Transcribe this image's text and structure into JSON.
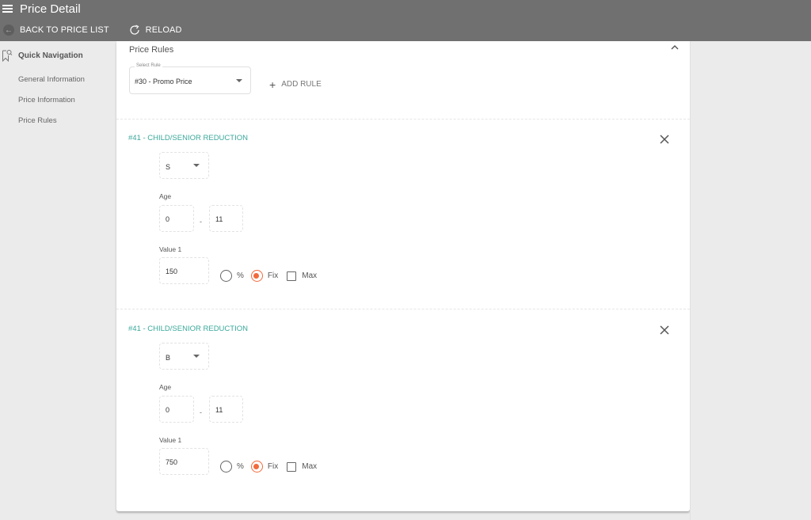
{
  "header": {
    "title": "Price Detail",
    "menu_icon": "hamburger-menu-icon",
    "back_label": "BACK TO PRICE LIST",
    "back_icon": "arrow-left-icon",
    "reload_label": "RELOAD",
    "reload_icon": "refresh-icon"
  },
  "sidebar": {
    "heading": "Quick Navigation",
    "heading_icon": "bookmark-search-icon",
    "items": [
      {
        "label": "General Information"
      },
      {
        "label": "Price Information"
      },
      {
        "label": "Price Rules"
      }
    ]
  },
  "price_rules": {
    "section_title": "Price Rules",
    "select_rule": {
      "label": "Select Rule",
      "value": "#30 - Promo Price"
    },
    "add_rule_label": "ADD RULE",
    "rules": [
      {
        "title": "#41 - CHILD/SENIOR REDUCTION",
        "type_value": "S",
        "age_label": "Age",
        "age_min": "0",
        "age_separator": "-",
        "age_max": "11",
        "value_label": "Value 1",
        "value": "150",
        "option_percent": "%",
        "option_fix": "Fix",
        "option_max": "Max",
        "selected_mode": "Fix",
        "max_checked": false
      },
      {
        "title": "#41 - CHILD/SENIOR REDUCTION",
        "type_value": "B",
        "age_label": "Age",
        "age_min": "0",
        "age_separator": "-",
        "age_max": "11",
        "value_label": "Value 1",
        "value": "750",
        "option_percent": "%",
        "option_fix": "Fix",
        "option_max": "Max",
        "selected_mode": "Fix",
        "max_checked": false
      }
    ]
  },
  "colors": {
    "header_bg": "#707070",
    "accent_teal": "#3aa89b",
    "radio_selected": "#f26a3b",
    "page_bg": "#ebebeb"
  }
}
